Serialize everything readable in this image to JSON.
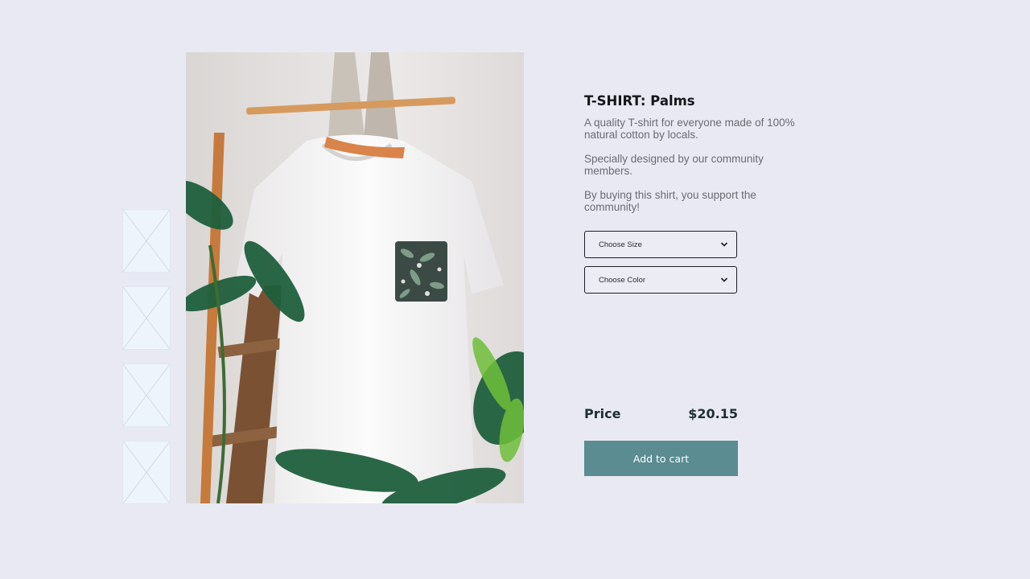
{
  "product": {
    "title": "T-SHIRT: Palms",
    "description": [
      "A quality T-shirt for everyone made of 100% natural cotton by locals.",
      "Specially designed by our community members.",
      "By buying this shirt, you support the community!"
    ]
  },
  "options": {
    "size_select": "Choose Size",
    "color_select": "Choose Color",
    "chevron_icon": "chevron-down-icon"
  },
  "pricing": {
    "price_label": "Price",
    "price_value": "$20.15"
  },
  "actions": {
    "add_to_cart": "Add to cart"
  },
  "gallery": {
    "thumbnail_count": 4,
    "thumbnail_icon": "image-placeholder-icon"
  },
  "colors": {
    "background": "#e9e9f3",
    "accent": "#5a8c92",
    "text_dark": "#15161a",
    "text_muted": "#6b6b73"
  }
}
